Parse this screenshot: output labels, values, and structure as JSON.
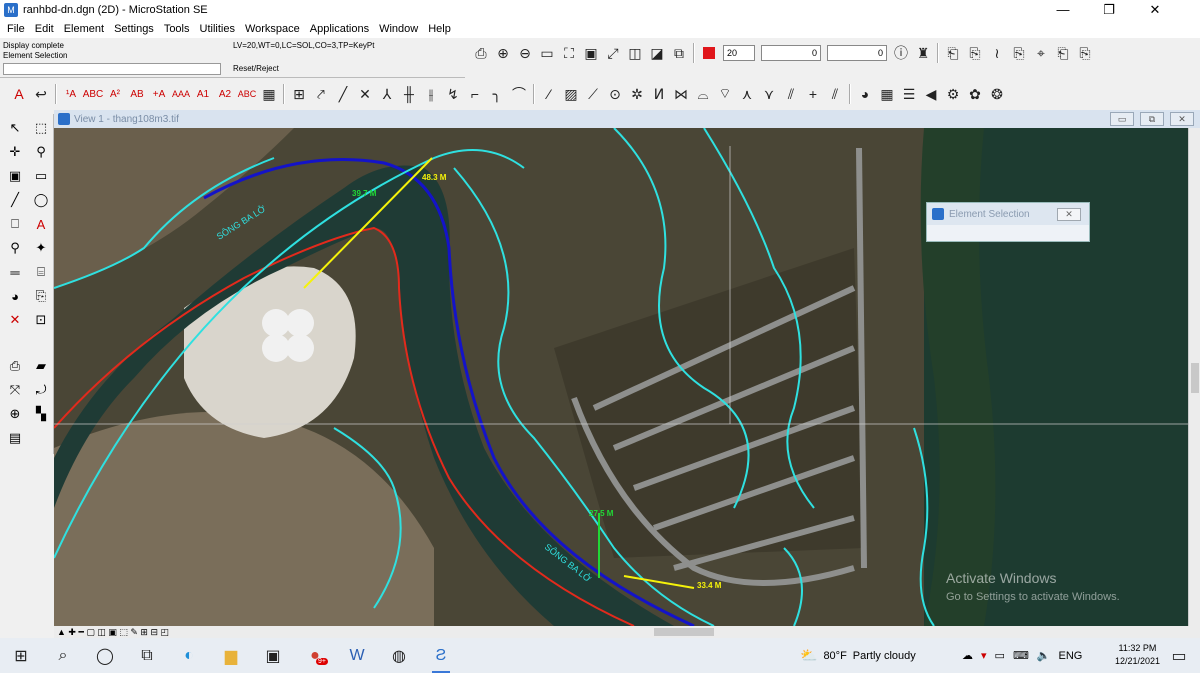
{
  "window": {
    "title": "ranhbd-dn.dgn (2D) - MicroStation SE",
    "minimize": "—",
    "maximize": "❐",
    "close": "✕"
  },
  "menu": [
    "File",
    "Edit",
    "Element",
    "Settings",
    "Tools",
    "Utilities",
    "Workspace",
    "Applications",
    "Window",
    "Help"
  ],
  "status": {
    "line1": "Display complete",
    "line2": "Element Selection",
    "input_value": "",
    "settings": "LV=20,WT=0,LC=SOL,CO=3,TP=KeyPt",
    "prompt": "Reset/Reject"
  },
  "attributes": {
    "color_value": "20",
    "style_value": "0",
    "weight_value": "0",
    "active_color": "#e0161b"
  },
  "view": {
    "title": "View 1 - thang108m3.tif"
  },
  "element_selection": {
    "title": "Element Selection"
  },
  "map_labels": {
    "river_name_1": "SÔNG BA LỞ",
    "river_name_2": "SÔNG BA LỞ",
    "dim_green_top": "39.7 M",
    "dim_yellow_top": "48.3 M",
    "dim_green_bottom": "27.5 M",
    "dim_yellow_bottom": "33.4 M"
  },
  "watermark": {
    "line1": "Activate Windows",
    "line2": "Go to Settings to activate Windows."
  },
  "taskbar": {
    "weather_temp": "80°F",
    "weather_text": "Partly cloudy",
    "language": "ENG",
    "time": "11:32 PM",
    "date": "12/21/2021",
    "notification_badge": "9+"
  },
  "colors": {
    "river": "#1f3b35",
    "boundary": "#2fe0e0",
    "river_bank_blue": "#1413c8",
    "river_bank_red": "#e22a1c",
    "dim_yellow": "#f5f20a",
    "dim_green": "#21d836"
  }
}
